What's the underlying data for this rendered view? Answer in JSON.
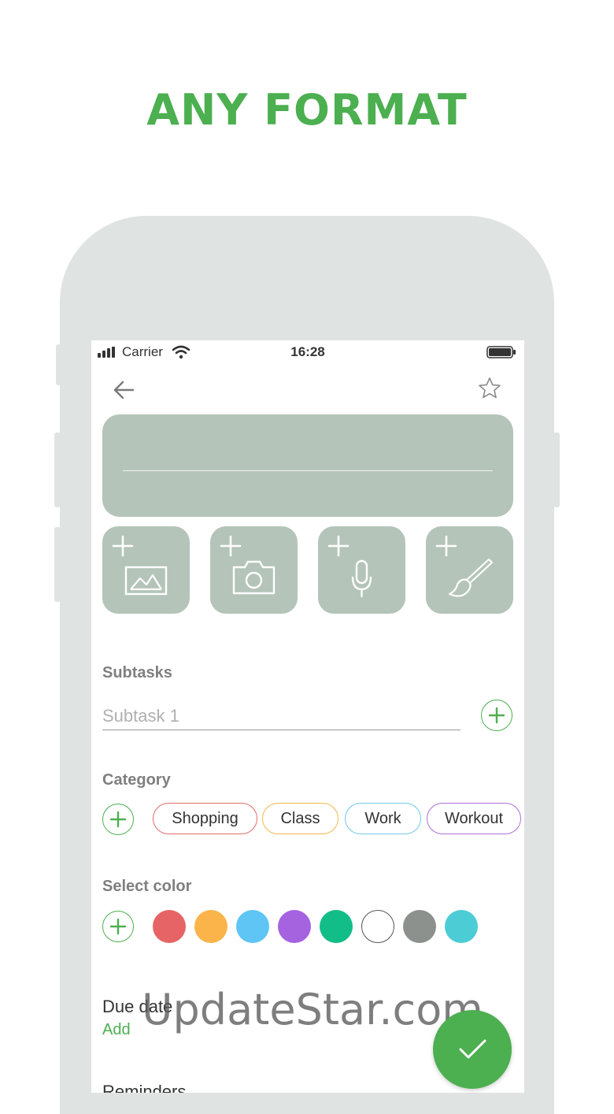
{
  "headline": "ANY FORMAT",
  "status_bar": {
    "carrier": "Carrier",
    "time": "16:28"
  },
  "attachments": [
    {
      "icon": "image-icon"
    },
    {
      "icon": "camera-icon"
    },
    {
      "icon": "microphone-icon"
    },
    {
      "icon": "brush-icon"
    }
  ],
  "subtasks": {
    "label": "Subtasks",
    "placeholder": "Subtask 1"
  },
  "category": {
    "label": "Category",
    "chips": [
      "Shopping",
      "Class",
      "Work",
      "Workout"
    ]
  },
  "select_color": {
    "label": "Select color",
    "colors": [
      "#e66465",
      "#fbb44a",
      "#5ec5f4",
      "#a563e0",
      "#13bd87",
      "#ffffff",
      "#8d918d",
      "#4cccd5"
    ]
  },
  "due_date": {
    "label": "Due date",
    "action": "Add"
  },
  "reminders": {
    "label": "Reminders"
  },
  "watermark": "UpdateStar.com",
  "theme": {
    "accent": "#4caf50",
    "card": "#b4c4b9",
    "frame": "#dfe3e2"
  }
}
